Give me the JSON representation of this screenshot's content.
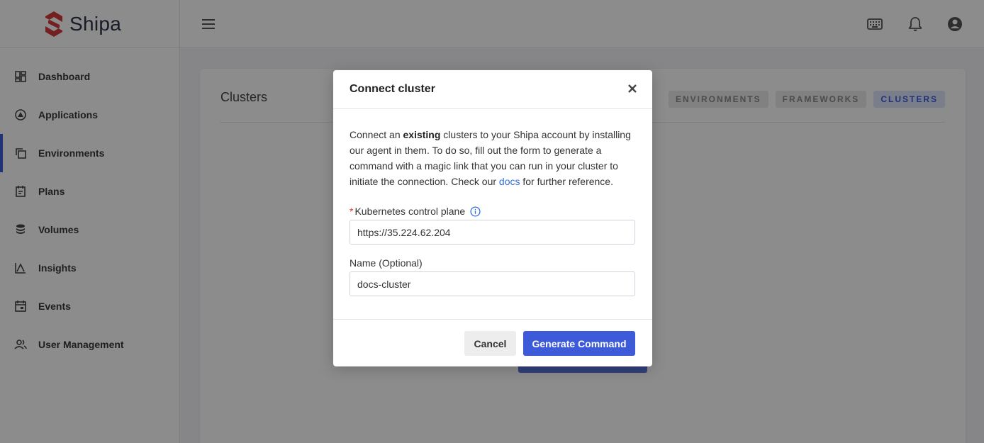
{
  "app": {
    "name": "Shipa"
  },
  "sidebar": {
    "items": [
      {
        "label": "Dashboard",
        "icon": "dashboard-icon"
      },
      {
        "label": "Applications",
        "icon": "applications-icon"
      },
      {
        "label": "Environments",
        "icon": "environments-icon",
        "active": true
      },
      {
        "label": "Plans",
        "icon": "plans-icon"
      },
      {
        "label": "Volumes",
        "icon": "volumes-icon"
      },
      {
        "label": "Insights",
        "icon": "insights-icon"
      },
      {
        "label": "Events",
        "icon": "events-icon"
      },
      {
        "label": "User Management",
        "icon": "user-management-icon"
      }
    ]
  },
  "topbar": {
    "icons": [
      "menu-icon",
      "keyboard-icon",
      "bell-icon",
      "account-icon"
    ]
  },
  "page": {
    "title": "Clusters",
    "tabs": [
      {
        "label": "ENVIRONMENTS"
      },
      {
        "label": "FRAMEWORKS"
      },
      {
        "label": "CLUSTERS",
        "active": true
      }
    ]
  },
  "modal": {
    "title": "Connect cluster",
    "description": {
      "part1": "Connect an ",
      "bold": "existing",
      "part2": " clusters to your Shipa account by installing our agent in them. To do so, fill out the form to generate a command with a magic link that you can run in your cluster to initiate the connection. Check our ",
      "link": "docs",
      "part3": " for further reference."
    },
    "fields": {
      "control_plane": {
        "label": "Kubernetes control plane",
        "required_mark": "*",
        "value": "https://35.224.62.204"
      },
      "name": {
        "label": "Name (Optional)",
        "value": "docs-cluster"
      }
    },
    "buttons": {
      "cancel": "Cancel",
      "generate": "Generate Command"
    }
  },
  "colors": {
    "accent": "#3d5bd9",
    "brand_red": "#d43b3b",
    "link": "#2f6fdb"
  }
}
